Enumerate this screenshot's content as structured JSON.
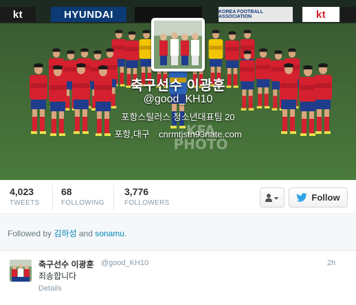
{
  "header": {
    "boards": [
      "kt",
      "HYUNDAI",
      "",
      "KOREA FOOTBALL ASSOCIATION",
      "kt",
      "kt"
    ],
    "display_name": "축구선수 이광훈",
    "handle": "@good_KH10",
    "bio": "포항스틸러스 청소년대표팀 20",
    "location": "포항,대구",
    "email": "cnrmtjstn93nate.com",
    "watermark": "KFA PHOTO"
  },
  "stats": [
    {
      "value": "4,023",
      "label": "TWEETS"
    },
    {
      "value": "68",
      "label": "FOLLOWING"
    },
    {
      "value": "3,776",
      "label": "FOLLOWERS"
    }
  ],
  "actions": {
    "follow_label": "Follow",
    "user_menu_icon": "user-dropdown-icon",
    "follow_icon": "twitter-bird-icon"
  },
  "followed_by": {
    "prefix": "Followed by",
    "user1": "김하성",
    "conjunction": "and",
    "user2": "sonamu",
    "suffix": "."
  },
  "tweet": {
    "name": "축구선수 이광훈",
    "handle": "@good_KH10",
    "time": "2h",
    "text": "죄송합니다",
    "details": "Details"
  },
  "colors": {
    "link": "#0084b4",
    "jersey_red": "#d4202f",
    "pitch_green": "#3d5f35",
    "twitter_blue": "#2fa5e6"
  }
}
